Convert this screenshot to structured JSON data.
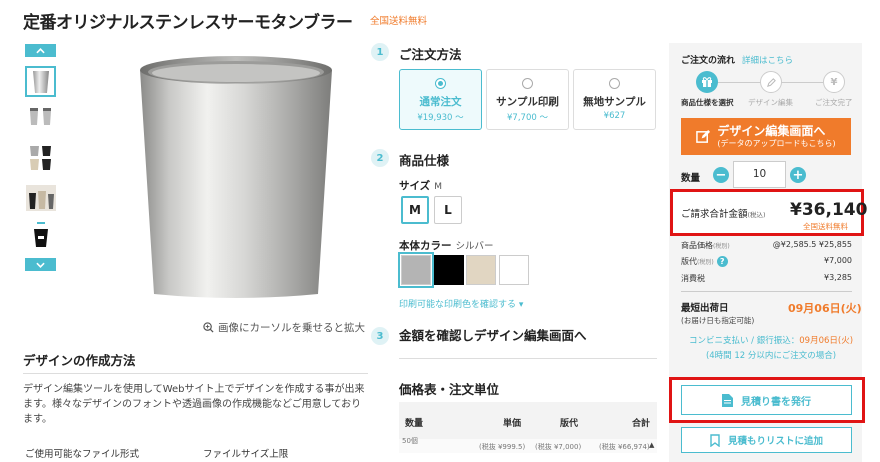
{
  "product": {
    "title": "定番オリジナルステンレスサーモタンブラー",
    "shipping_badge": "全国送料無料",
    "zoom_note": "画像にカーソルを乗せると拡大"
  },
  "design_howto": {
    "title": "デザインの作成方法",
    "description": "デザイン編集ツールを使用してWebサイト上でデザインを作成する事が出来ます。様々なデザインのフォントや透過画像の作成機能などご用意しております。",
    "col_format": "ご使用可能なファイル形式",
    "col_size": "ファイルサイズ上限"
  },
  "steps": [
    {
      "num": "1",
      "title": "ご注文方法"
    },
    {
      "num": "2",
      "title": "商品仕様"
    },
    {
      "num": "3",
      "title": "金額を確認しデザイン編集画面へ"
    }
  ],
  "order_options": [
    {
      "name": "通常注文",
      "price": "¥19,930 〜",
      "selected": true
    },
    {
      "name": "サンプル印刷",
      "price": "¥7,700 〜",
      "selected": false
    },
    {
      "name": "無地サンプル",
      "price": "¥627",
      "selected": false
    }
  ],
  "spec": {
    "size_label": "サイズ",
    "size_value": "M",
    "sizes": [
      "M",
      "L"
    ],
    "color_label": "本体カラー",
    "color_value": "シルバー",
    "colors": [
      "#b4b4b4",
      "#000000",
      "#e1d6c2",
      "#ffffff"
    ],
    "print_colors_link": "印刷可能な印刷色を確認する ▾"
  },
  "price_table": {
    "title": "価格表・注文単位",
    "headers": [
      "数量",
      "単価",
      "版代",
      "合計"
    ],
    "row": [
      "50個",
      "(税抜 ¥999.5)",
      "(税抜 ¥7,000)",
      "(税抜 ¥66,974)"
    ]
  },
  "panel": {
    "flow_title": "ご注文の流れ",
    "flow_link": "詳細はこちら",
    "flow_steps": [
      "商品仕様を選択",
      "デザイン編集",
      "ご注文完了"
    ],
    "design_button_main": "デザイン編集画面へ",
    "design_button_sub": "(データのアップロードもこちら)",
    "qty_label": "数量",
    "qty_value": "10",
    "total_label": "ご請求合計金額",
    "total_label_note": "(税込)",
    "total_value": "¥36,140",
    "total_free": "全国送料無料",
    "breakdown": [
      {
        "label": "商品価格",
        "note": "(税別)",
        "value": "@¥2,585.5 ¥25,855"
      },
      {
        "label": "版代",
        "note": "(税別)",
        "value": "¥7,000"
      },
      {
        "label": "消費税",
        "note": "",
        "value": "¥3,285"
      }
    ],
    "ship_title": "最短出荷日",
    "ship_sub": "(お届け日も指定可能)",
    "ship_date": "09月06日(火)",
    "conv_prefix": "コンビニ支払い / 銀行振込：",
    "conv_date": "09月06日(火)",
    "conv_sub": "(4時間 12 分以内にご注文の場合)",
    "quote_button": "見積り書を発行",
    "wishlist_button": "見積もりリストに追加"
  },
  "icons": [
    "zoom-icon",
    "edit-icon",
    "gift-icon",
    "pencil-icon",
    "yen-icon",
    "document-icon",
    "bookmark-icon",
    "chevron-up-icon",
    "chevron-down-icon"
  ],
  "colors": {
    "accent": "#4bbccf",
    "orange": "#f07b2b",
    "highlight": "#e01414"
  }
}
